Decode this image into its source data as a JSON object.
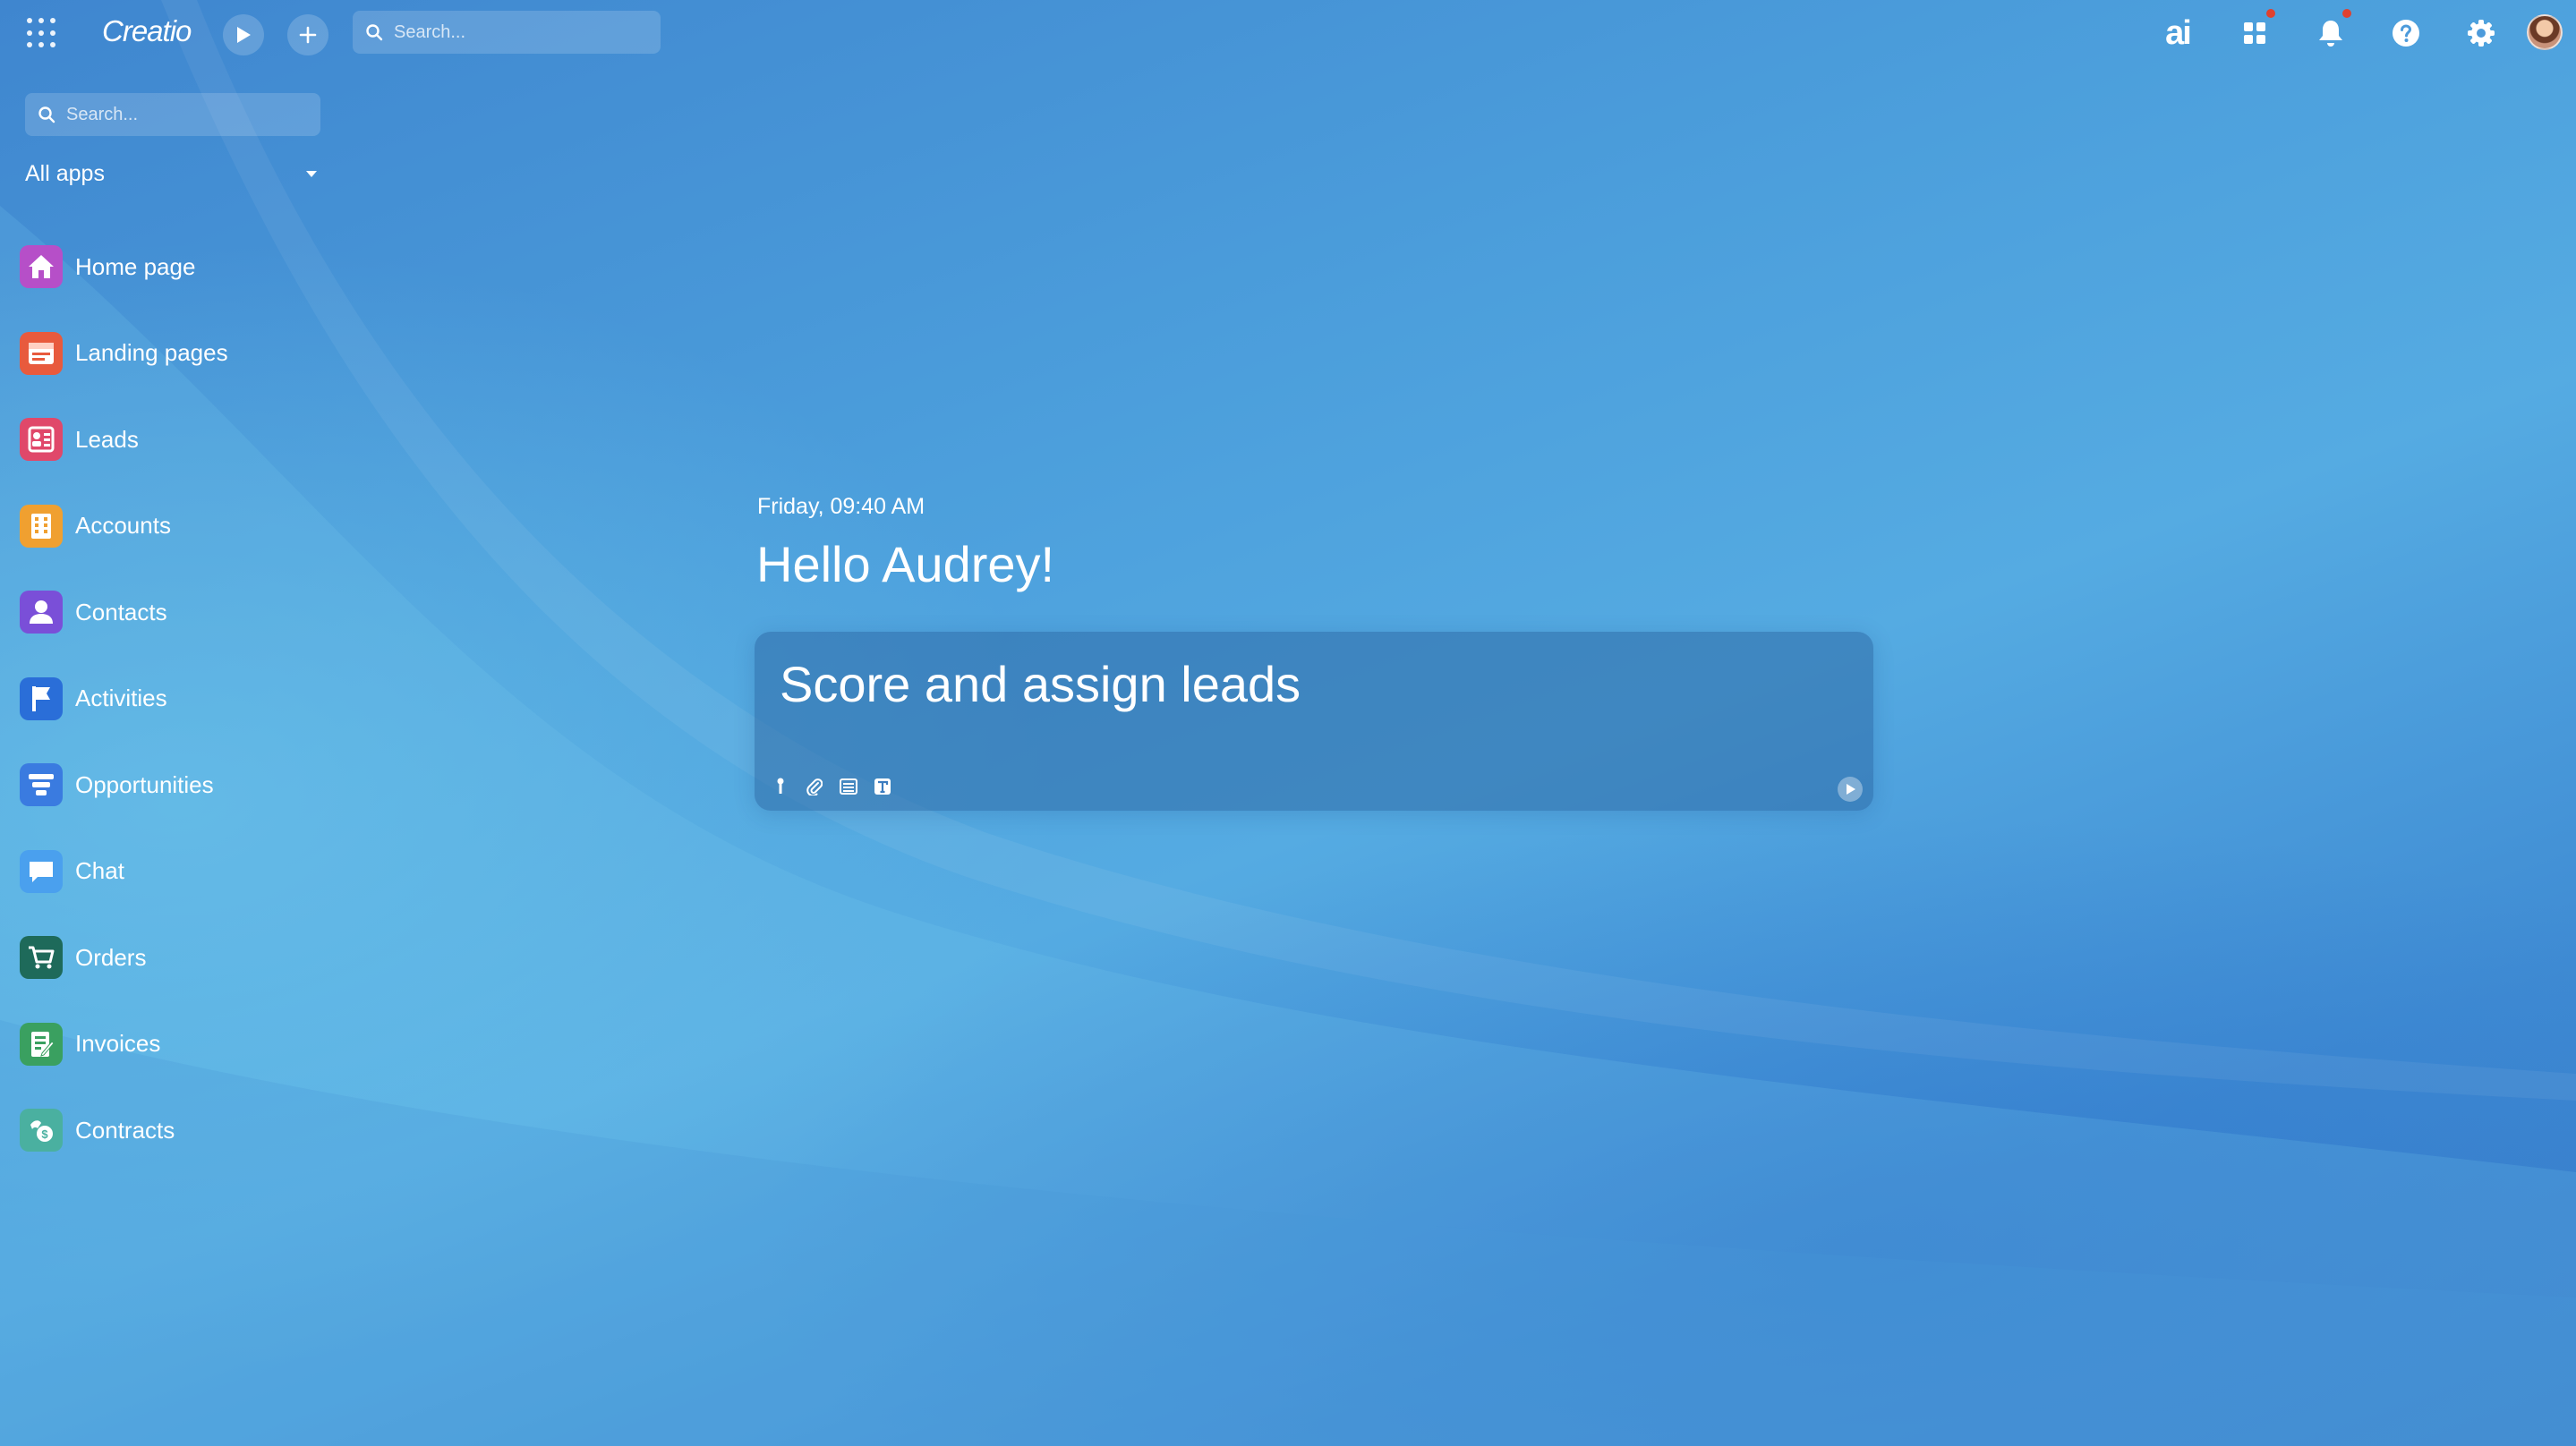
{
  "header": {
    "logo": "Creatio",
    "search_placeholder": "Search...",
    "icons": [
      "apps-grid-icon",
      "play-icon",
      "plus-icon",
      "search-icon",
      "ai-icon",
      "app-hub-icon",
      "bell-icon",
      "help-icon",
      "gear-icon",
      "avatar"
    ]
  },
  "sidebar": {
    "search_placeholder": "Search...",
    "filter_label": "All apps",
    "items": [
      {
        "label": "Home page",
        "icon": "home-icon",
        "color": "#b64fc8"
      },
      {
        "label": "Landing pages",
        "icon": "landing-page-icon",
        "color": "#e85a3d"
      },
      {
        "label": "Leads",
        "icon": "leads-icon",
        "color": "#e0486a"
      },
      {
        "label": "Accounts",
        "icon": "building-icon",
        "color": "#f0a030"
      },
      {
        "label": "Contacts",
        "icon": "person-icon",
        "color": "#7a4fd8"
      },
      {
        "label": "Activities",
        "icon": "flag-icon",
        "color": "#2a6ed8"
      },
      {
        "label": "Opportunities",
        "icon": "funnel-icon",
        "color": "#3a7be0"
      },
      {
        "label": "Chat",
        "icon": "chat-icon",
        "color": "#4aa0ee"
      },
      {
        "label": "Orders",
        "icon": "cart-icon",
        "color": "#1e6a5a"
      },
      {
        "label": "Invoices",
        "icon": "invoice-icon",
        "color": "#3aa060"
      },
      {
        "label": "Contracts",
        "icon": "contract-icon",
        "color": "#4ab0a0"
      }
    ]
  },
  "main": {
    "datetime": "Friday, 09:40 AM",
    "greeting": "Hello Audrey!",
    "prompt": {
      "text": "Score and assign leads",
      "tools": [
        "pin-icon",
        "paperclip-icon",
        "list-icon",
        "text-icon"
      ],
      "send_icon": "send-icon"
    }
  }
}
